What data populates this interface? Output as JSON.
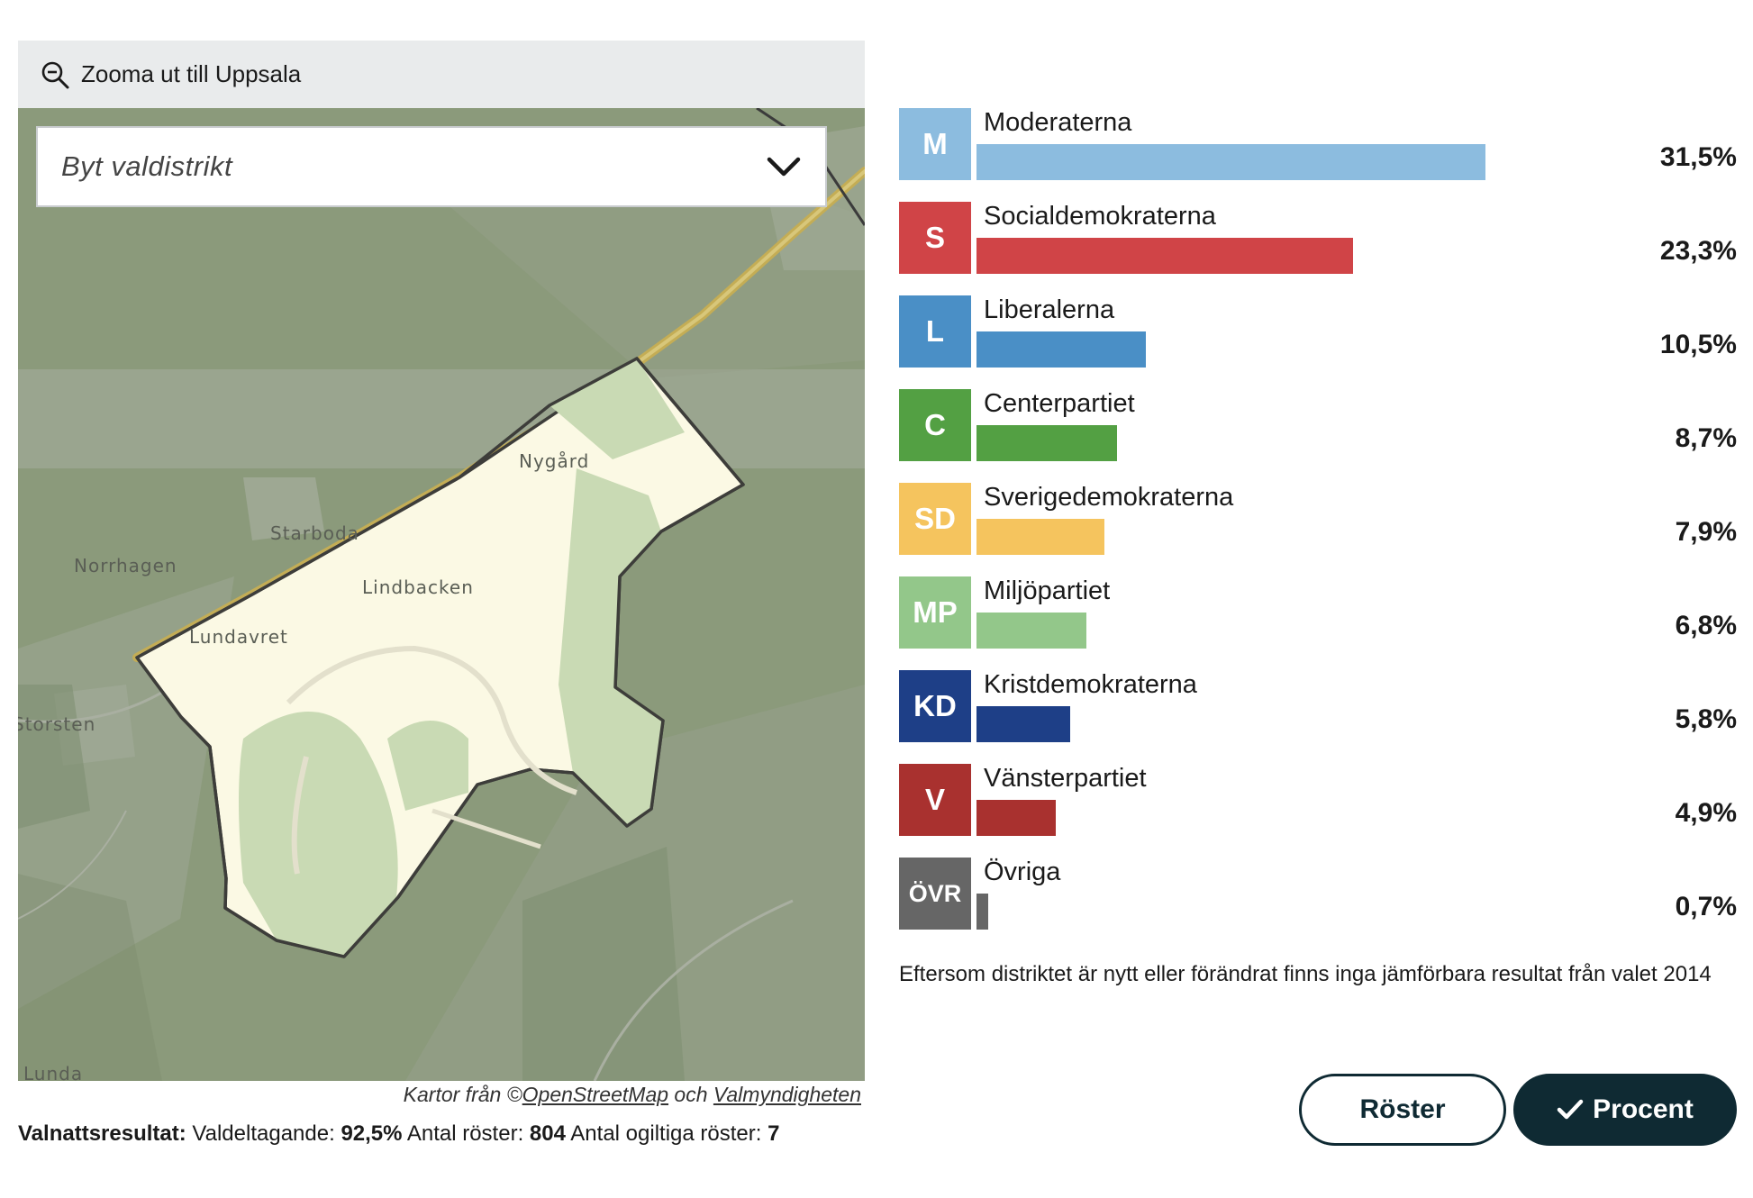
{
  "map": {
    "zoom_out_label": "Zooma ut till Uppsala",
    "district_select_placeholder": "Byt valdistrikt",
    "place_labels": [
      "Nygård",
      "Starboda",
      "Norrhagen",
      "Lindbacken",
      "Lundavret",
      "Storsten",
      "Lunda"
    ],
    "attribution_prefix": "Kartor från ©",
    "attribution_osm": "OpenStreetMap",
    "attribution_and": " och ",
    "attribution_val": "Valmyndigheten"
  },
  "summary": {
    "label": "Valnattsresultat:",
    "turnout_label": " Valdeltagande: ",
    "turnout_value": "92,5%",
    "votes_label": " Antal röster: ",
    "votes_value": "804",
    "invalid_label": " Antal ogiltiga röster: ",
    "invalid_value": "7"
  },
  "chart_data": {
    "type": "bar",
    "categories": [
      "Moderaterna",
      "Socialdemokraterna",
      "Liberalerna",
      "Centerpartiet",
      "Sverigedemokraterna",
      "Miljöpartiet",
      "Kristdemokraterna",
      "Vänsterpartiet",
      "Övriga"
    ],
    "abbreviations": [
      "M",
      "S",
      "L",
      "C",
      "SD",
      "MP",
      "KD",
      "V",
      "ÖVR"
    ],
    "values": [
      31.5,
      23.3,
      10.5,
      8.7,
      7.9,
      6.8,
      5.8,
      4.9,
      0.7
    ],
    "value_labels": [
      "31,5%",
      "23,3%",
      "10,5%",
      "8,7%",
      "7,9%",
      "6,8%",
      "5,8%",
      "4,9%",
      "0,7%"
    ],
    "colors": [
      "#8cbcdf",
      "#d04447",
      "#4a8fc6",
      "#53a043",
      "#f5c45e",
      "#93c78a",
      "#1e3f87",
      "#a9312f",
      "#666666"
    ],
    "orientation": "horizontal",
    "unit": "%"
  },
  "note": "Eftersom distriktet är nytt eller förändrat finns inga jämförbara resultat från valet 2014",
  "buttons": {
    "votes_label": "Röster",
    "percent_label": "Procent"
  },
  "icons": {
    "zoom": "zoom-out-icon",
    "dropdown": "chevron-down-icon",
    "check": "check-icon"
  }
}
